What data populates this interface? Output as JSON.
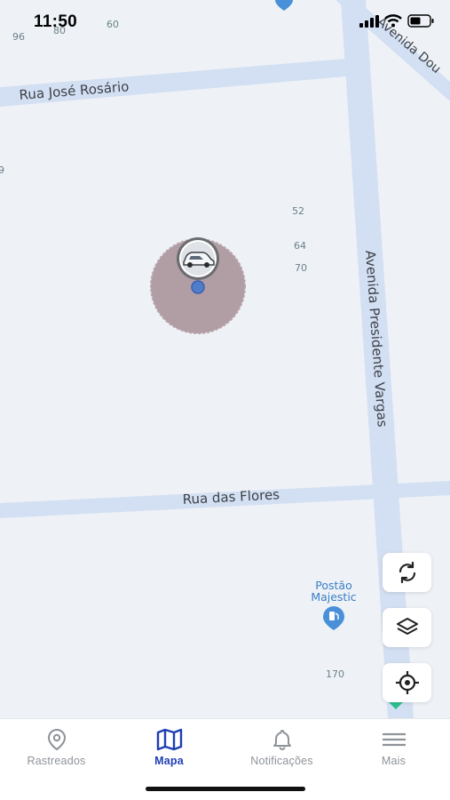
{
  "status_bar": {
    "time": "11:50"
  },
  "map": {
    "streets": {
      "rua_jose_rosario": "Rua José Rosário",
      "avenida_presidente_vargas": "Avenida Presidente Vargas",
      "rua_das_flores": "Rua das Flores",
      "avenida_dou": "Avenida Dou"
    },
    "numbers": [
      "96",
      "80",
      "60",
      "9",
      "52",
      "64",
      "70",
      "170"
    ],
    "poi": {
      "line1": "Postão",
      "line2": "Majestic"
    }
  },
  "tabs": [
    {
      "label": "Rastreados",
      "icon": "location-pin-icon",
      "active": false
    },
    {
      "label": "Mapa",
      "icon": "map-icon",
      "active": true
    },
    {
      "label": "Notificações",
      "icon": "bell-icon",
      "active": false
    },
    {
      "label": "Mais",
      "icon": "menu-icon",
      "active": false
    }
  ],
  "colors": {
    "map_background": "#eef2f6",
    "road": "#d3dff2",
    "active_tab": "#1f3fb3",
    "inactive_tab": "#8e939a",
    "accuracy_circle": "#9c8088",
    "poi": "#4a90d9"
  }
}
